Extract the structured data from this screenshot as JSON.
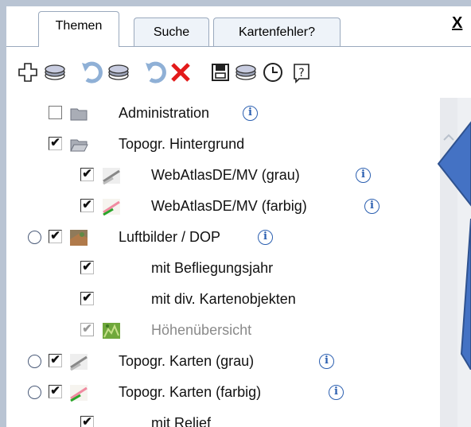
{
  "tabs": [
    {
      "label": "Themen",
      "active": true
    },
    {
      "label": "Suche",
      "active": false
    },
    {
      "label": "Kartenfehler?",
      "active": false
    }
  ],
  "close_label": "X",
  "toolbar": {
    "icons": [
      "add-icon",
      "layers-icon",
      "refresh-icon",
      "layers-icon",
      "refresh-icon",
      "delete-icon",
      "save-icon",
      "layers-icon",
      "clock-icon",
      "help-icon"
    ]
  },
  "tree": {
    "info_glyph": "i",
    "checkmark": "✔",
    "items": [
      {
        "label": "Administration",
        "checked": false,
        "icon": "folder-icon",
        "info": true
      },
      {
        "label": "Topogr. Hintergrund",
        "checked": true,
        "icon": "folder-open-icon",
        "info": false
      },
      {
        "label": "WebAtlasDE/MV (grau)",
        "checked": true,
        "icon": "map-grey-icon",
        "info": true
      },
      {
        "label": "WebAtlasDE/MV (farbig)",
        "checked": true,
        "icon": "map-color-icon",
        "info": true
      },
      {
        "label": "Luftbilder / DOP",
        "checked": true,
        "icon": "aerial-photo-icon",
        "info": true,
        "radio": true
      },
      {
        "label": "mit Befliegungsjahr",
        "checked": true,
        "icon": null,
        "info": false
      },
      {
        "label": "mit div. Kartenobjekten",
        "checked": true,
        "icon": null,
        "info": false
      },
      {
        "label": "Höhenübersicht",
        "checked": true,
        "icon": "elevation-icon",
        "info": false,
        "disabled": true
      },
      {
        "label": "Topogr. Karten (grau)",
        "checked": true,
        "icon": "map-grey-icon",
        "info": true,
        "radio": true
      },
      {
        "label": "Topogr. Karten (farbig)",
        "checked": true,
        "icon": "map-color-icon",
        "info": true,
        "radio": true
      },
      {
        "label": "mit Relief",
        "checked": true,
        "icon": null,
        "info": false
      }
    ]
  },
  "colors": {
    "accent_blue": "#4472c4",
    "delete_red": "#e31b1b",
    "tab_border": "#9aa9bd"
  }
}
